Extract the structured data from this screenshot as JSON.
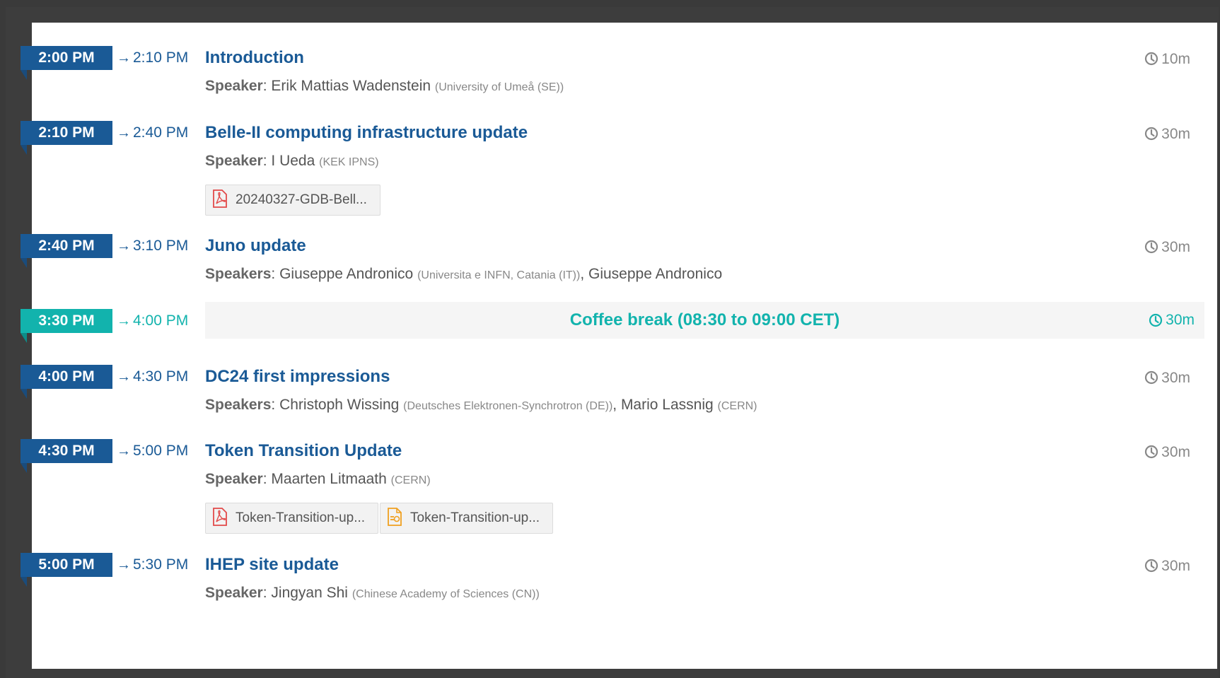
{
  "arrow": "→",
  "colors": {
    "accent": "#1a5a96",
    "break": "#12b3ad",
    "pdf": "#e24a4a",
    "presentation": "#f0a020"
  },
  "contributions": [
    {
      "start": "2:00 PM",
      "end": "2:10 PM",
      "title": "Introduction",
      "speaker_label": "Speaker",
      "speakers": [
        {
          "name": "Erik Mattias Wadenstein",
          "affiliation": "(University of Umeå (SE))"
        }
      ],
      "duration": "10m",
      "attachments": []
    },
    {
      "start": "2:10 PM",
      "end": "2:40 PM",
      "title": "Belle-II computing infrastructure update",
      "speaker_label": "Speaker",
      "speakers": [
        {
          "name": "I Ueda",
          "affiliation": "(KEK IPNS)"
        }
      ],
      "duration": "30m",
      "attachments": [
        {
          "icon": "pdf-icon",
          "label": "20240327-GDB-Bell..."
        }
      ]
    },
    {
      "start": "2:40 PM",
      "end": "3:10 PM",
      "title": "Juno update",
      "speaker_label": "Speakers",
      "speakers": [
        {
          "name": "Giuseppe Andronico",
          "affiliation": "(Universita e INFN, Catania (IT))"
        },
        {
          "name": "Giuseppe Andronico",
          "affiliation": ""
        }
      ],
      "duration": "30m",
      "attachments": []
    },
    {
      "is_break": true,
      "start": "3:30 PM",
      "end": "4:00 PM",
      "title": "Coffee break (08:30 to 09:00 CET)",
      "duration": "30m"
    },
    {
      "start": "4:00 PM",
      "end": "4:30 PM",
      "title": "DC24 first impressions",
      "speaker_label": "Speakers",
      "speakers": [
        {
          "name": "Christoph Wissing",
          "affiliation": "(Deutsches Elektronen-Synchrotron (DE))"
        },
        {
          "name": "Mario Lassnig",
          "affiliation": "(CERN)"
        }
      ],
      "duration": "30m",
      "attachments": []
    },
    {
      "start": "4:30 PM",
      "end": "5:00 PM",
      "title": "Token Transition Update",
      "speaker_label": "Speaker",
      "speakers": [
        {
          "name": "Maarten Litmaath",
          "affiliation": "(CERN)"
        }
      ],
      "duration": "30m",
      "attachments": [
        {
          "icon": "pdf-icon",
          "label": "Token-Transition-up..."
        },
        {
          "icon": "presentation-icon",
          "label": "Token-Transition-up..."
        }
      ]
    },
    {
      "start": "5:00 PM",
      "end": "5:30 PM",
      "title": "IHEP site update",
      "speaker_label": "Speaker",
      "speakers": [
        {
          "name": "Jingyan Shi",
          "affiliation": "(Chinese Academy of Sciences (CN))"
        }
      ],
      "duration": "30m",
      "attachments": []
    }
  ]
}
